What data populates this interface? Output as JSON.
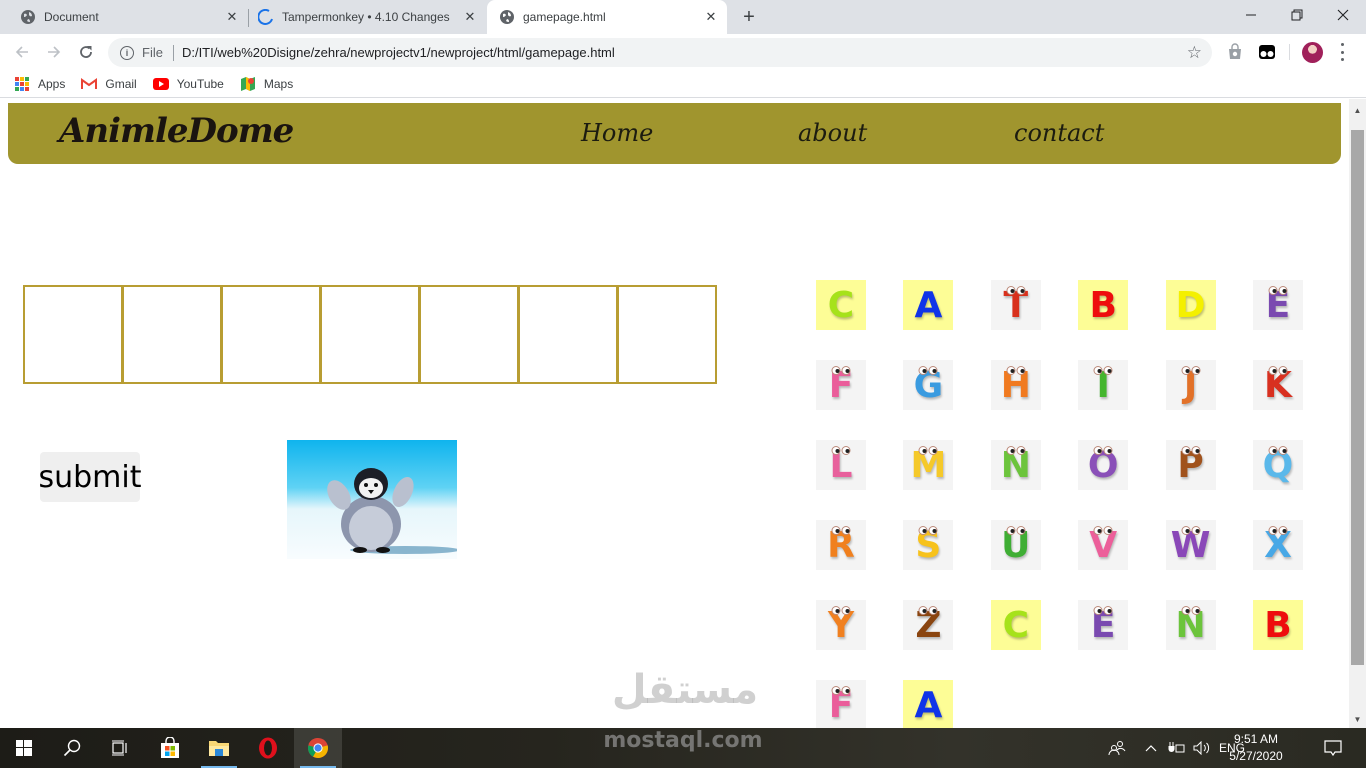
{
  "browser": {
    "tabs": [
      {
        "title": "Document",
        "favicon": "globe-icon",
        "active": false
      },
      {
        "title": "Tampermonkey • 4.10 Changes",
        "favicon": "tampermonkey-loading-icon",
        "active": false
      },
      {
        "title": "gamepage.html",
        "favicon": "globe-icon",
        "active": true
      }
    ],
    "new_tab_symbol": "+",
    "close_symbol": "✕",
    "window_controls": {
      "minimize": "—",
      "restore": "❐",
      "close": "✕"
    },
    "address": {
      "scheme_label": "File",
      "url": "D:/ITI/web%20Disigne/zehra/newprojectv1/newproject/html/gamepage.html"
    },
    "bookmarks": [
      {
        "label": "Apps",
        "icon": "apps-grid-icon"
      },
      {
        "label": "Gmail",
        "icon": "gmail-icon"
      },
      {
        "label": "YouTube",
        "icon": "youtube-icon"
      },
      {
        "label": "Maps",
        "icon": "maps-icon"
      }
    ]
  },
  "page": {
    "navbar": {
      "logo": "AnimleDome",
      "links": [
        "Home",
        "about",
        "contact"
      ],
      "background": "#a0952e"
    },
    "answer_boxes_count": 7,
    "answer_boxes": [
      "",
      "",
      "",
      "",
      "",
      "",
      ""
    ],
    "box_border_color": "#b89d32",
    "submit_label": "submit",
    "image_alt": "dancing penguin",
    "letter_tiles": [
      {
        "letter": "C",
        "color": "#a6e21a",
        "bg": "yellow"
      },
      {
        "letter": "A",
        "color": "#1034e8",
        "bg": "yellow"
      },
      {
        "letter": "T",
        "color": "#d8301c",
        "bg": "grey"
      },
      {
        "letter": "B",
        "color": "#ee0d0d",
        "bg": "yellow"
      },
      {
        "letter": "D",
        "color": "#f4f000",
        "bg": "yellow"
      },
      {
        "letter": "E",
        "color": "#7a4ab0",
        "bg": "grey"
      },
      {
        "letter": "F",
        "color": "#ea5d9a",
        "bg": "grey"
      },
      {
        "letter": "G",
        "color": "#3a9be0",
        "bg": "grey"
      },
      {
        "letter": "H",
        "color": "#f07a20",
        "bg": "grey"
      },
      {
        "letter": "I",
        "color": "#44b52e",
        "bg": "grey"
      },
      {
        "letter": "J",
        "color": "#e27128",
        "bg": "grey"
      },
      {
        "letter": "K",
        "color": "#d83020",
        "bg": "grey"
      },
      {
        "letter": "L",
        "color": "#e8609c",
        "bg": "grey"
      },
      {
        "letter": "M",
        "color": "#f5c92a",
        "bg": "grey"
      },
      {
        "letter": "N",
        "color": "#6cc43c",
        "bg": "grey"
      },
      {
        "letter": "O",
        "color": "#8a50b8",
        "bg": "grey"
      },
      {
        "letter": "P",
        "color": "#a0521c",
        "bg": "grey"
      },
      {
        "letter": "Q",
        "color": "#5ab8ea",
        "bg": "grey"
      },
      {
        "letter": "R",
        "color": "#f0801e",
        "bg": "grey"
      },
      {
        "letter": "S",
        "color": "#f7c21c",
        "bg": "grey"
      },
      {
        "letter": "U",
        "color": "#3fae34",
        "bg": "grey"
      },
      {
        "letter": "V",
        "color": "#ec5f9a",
        "bg": "grey"
      },
      {
        "letter": "W",
        "color": "#8a48b8",
        "bg": "grey"
      },
      {
        "letter": "X",
        "color": "#48a8e6",
        "bg": "grey"
      },
      {
        "letter": "Y",
        "color": "#f08020",
        "bg": "grey"
      },
      {
        "letter": "Z",
        "color": "#8a4510",
        "bg": "grey"
      },
      {
        "letter": "C",
        "color": "#a6e21a",
        "bg": "yellow"
      },
      {
        "letter": "E",
        "color": "#7a4ab0",
        "bg": "grey"
      },
      {
        "letter": "N",
        "color": "#6cc43c",
        "bg": "grey"
      },
      {
        "letter": "B",
        "color": "#ee0d0d",
        "bg": "yellow"
      },
      {
        "letter": "F",
        "color": "#ea5d9a",
        "bg": "grey"
      },
      {
        "letter": "A",
        "color": "#1034e8",
        "bg": "yellow"
      }
    ]
  },
  "watermark": {
    "arabic": "مستقل",
    "latin": "mostaql.com"
  },
  "taskbar": {
    "apps": [
      "windows-start-icon",
      "search-icon",
      "task-view-icon",
      "microsoft-store-icon",
      "file-explorer-icon",
      "opera-icon",
      "chrome-icon"
    ],
    "tray": {
      "language": "ENG",
      "time": "9:51 AM",
      "date": "5/27/2020"
    }
  }
}
